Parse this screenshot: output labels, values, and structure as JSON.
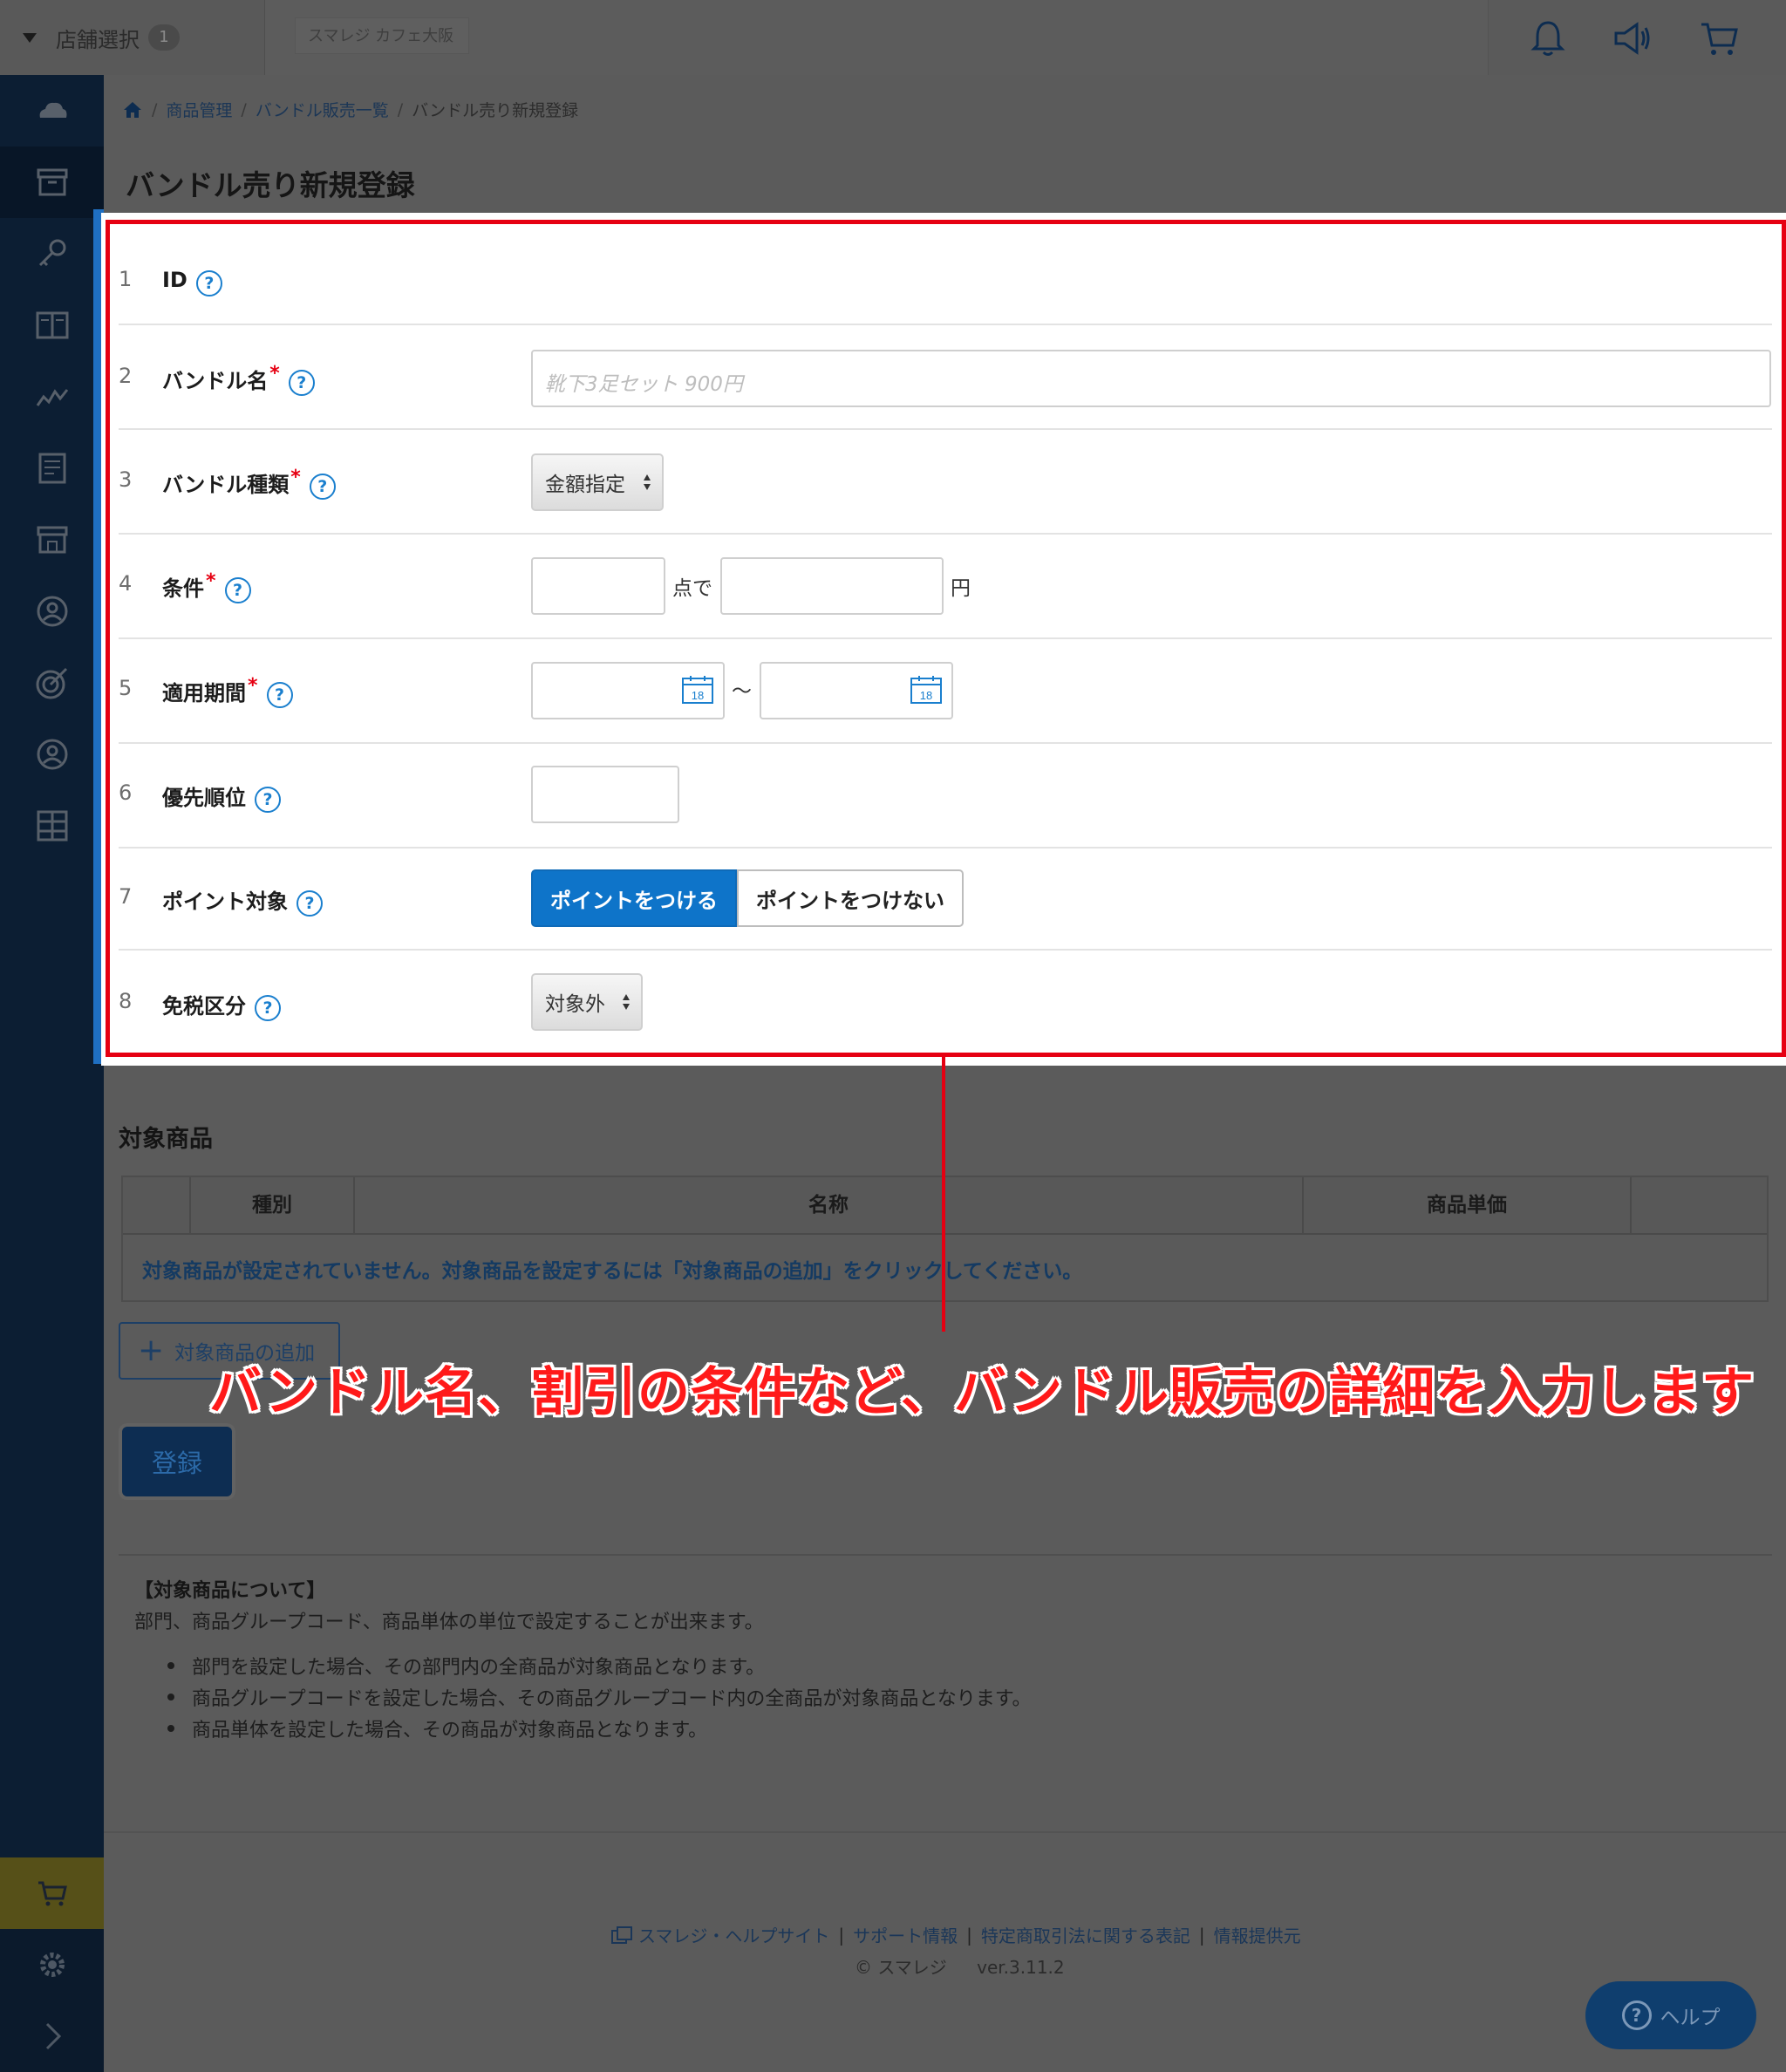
{
  "header": {
    "store_select_label": "店舗選択",
    "store_count": "1",
    "store_name": "スマレジ カフェ大阪"
  },
  "sidebar": {
    "icons": [
      "cloud-icon",
      "archive-icon",
      "key-icon",
      "book-icon",
      "chart-icon",
      "report-icon",
      "store-icon",
      "user-circle-icon",
      "target-icon",
      "member-icon",
      "grid-icon",
      "cart-icon",
      "gear-icon",
      "chevron-right-icon"
    ]
  },
  "breadcrumb": {
    "items": [
      "商品管理",
      "バンドル販売一覧"
    ],
    "current": "バンドル売り新規登録"
  },
  "page_title": "バンドル売り新規登録",
  "form": {
    "rows": [
      {
        "num": "1",
        "label": "ID",
        "required": false
      },
      {
        "num": "2",
        "label": "バンドル名",
        "required": true
      },
      {
        "num": "3",
        "label": "バンドル種類",
        "required": true
      },
      {
        "num": "4",
        "label": "条件",
        "required": true
      },
      {
        "num": "5",
        "label": "適用期間",
        "required": true
      },
      {
        "num": "6",
        "label": "優先順位",
        "required": false
      },
      {
        "num": "7",
        "label": "ポイント対象",
        "required": false
      },
      {
        "num": "8",
        "label": "免税区分",
        "required": false
      }
    ],
    "required_mark": "*",
    "help_mark": "?",
    "bundle_name_placeholder": "靴下3足セット 900円",
    "bundle_type_value": "金額指定",
    "condition_unit_qty": "点で",
    "condition_unit_yen": "円",
    "period_separator": "〜",
    "calendar_day": "18",
    "point_on_label": "ポイントをつける",
    "point_off_label": "ポイントをつけない",
    "tax_free_value": "対象外"
  },
  "annotation": "バンドル名、割引の条件など、バンドル販売の詳細を入力します",
  "target_products": {
    "title": "対象商品",
    "columns": [
      "種別",
      "名称",
      "商品単価"
    ],
    "empty_message": "対象商品が設定されていません。対象商品を設定するには「対象商品の追加」をクリックしてください。",
    "add_button_label": "対象商品の追加"
  },
  "register_button_label": "登録",
  "notes": {
    "title": "【対象商品について】",
    "description": "部門、商品グループコード、商品単体の単位で設定することが出来ます。",
    "items": [
      "部門を設定した場合、その部門内の全商品が対象商品となります。",
      "商品グループコードを設定した場合、その商品グループコード内の全商品が対象商品となります。",
      "商品単体を設定した場合、その商品が対象商品となります。"
    ]
  },
  "footer": {
    "links": [
      "スマレジ・ヘルプサイト",
      "サポート情報",
      "特定商取引法に関する表記",
      "情報提供元"
    ],
    "copyright": "© スマレジ",
    "version": "ver.3.11.2"
  },
  "help_button_label": "ヘルプ",
  "colors": {
    "accent": "#0e74c9",
    "highlight": "#e60012",
    "sidebar": "#0c1e33"
  }
}
